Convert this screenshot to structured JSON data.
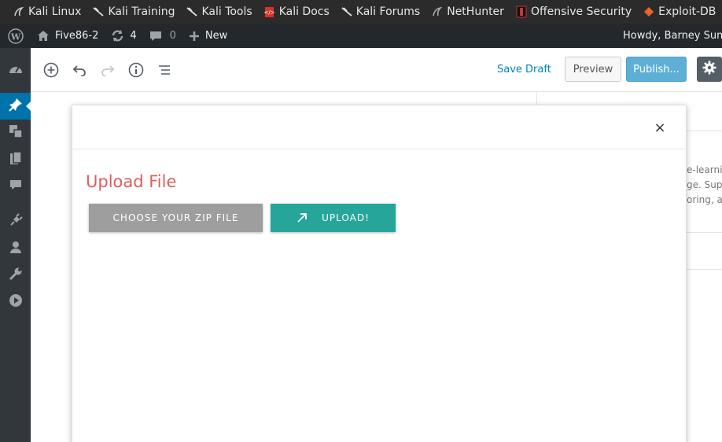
{
  "bookmarks": [
    {
      "label": "Kali Linux",
      "icon": "kali-dragon-icon"
    },
    {
      "label": "Kali Training",
      "icon": "kali-dragon-icon"
    },
    {
      "label": "Kali Tools",
      "icon": "kali-dragon-icon"
    },
    {
      "label": "Kali Docs",
      "icon": "kali-docs-icon"
    },
    {
      "label": "Kali Forums",
      "icon": "kali-dragon-icon"
    },
    {
      "label": "NetHunter",
      "icon": "nethunter-icon"
    },
    {
      "label": "Offensive Security",
      "icon": "offsec-icon"
    },
    {
      "label": "Exploit-DB",
      "icon": "exploit-db-icon"
    }
  ],
  "adminbar": {
    "site_name": "Five86-2",
    "updates_count": "4",
    "comments_count": "0",
    "new_label": "New",
    "howdy": "Howdy, Barney Sumne"
  },
  "toolbar": {
    "save_draft": "Save Draft",
    "preview": "Preview",
    "publish": "Publish..."
  },
  "sidebar_snippets": [
    "e-learni",
    "ge. Supp",
    "oring, ar"
  ],
  "modal": {
    "title": "Upload File",
    "close": "×",
    "choose_button": "CHOOSE YOUR ZIP FILE",
    "upload_button": "UPLOAD!"
  },
  "colors": {
    "admin_bar": "#23282d",
    "accent_blue": "#0073aa",
    "publish_button": "#5eafd6",
    "upload_title": "#e05d5d",
    "choose_button": "#9e9e9e",
    "upload_button": "#26a69a"
  }
}
